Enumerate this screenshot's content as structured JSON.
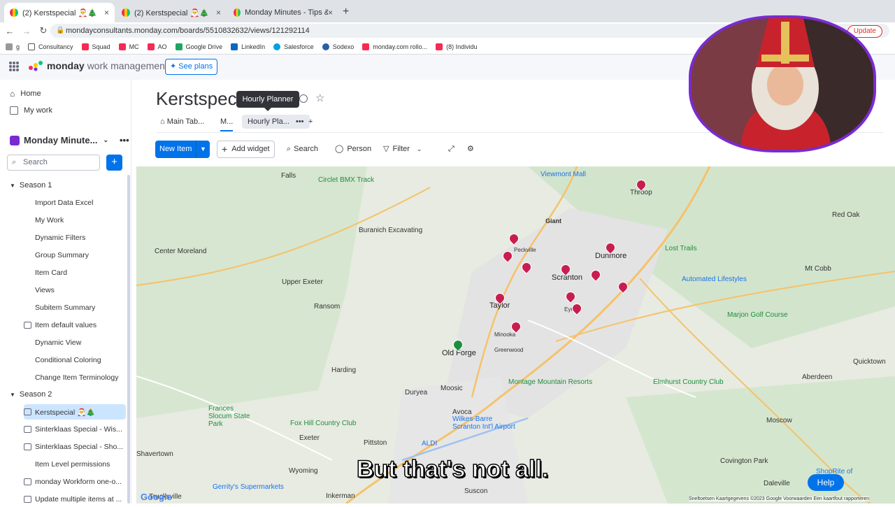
{
  "browser": {
    "tabs": [
      {
        "label": "(2) Kerstspecial 🎅🎄",
        "active": true
      },
      {
        "label": "(2) Kerstspecial 🎅🎄",
        "active": false
      },
      {
        "label": "Monday Minutes - Tips & Tric",
        "active": false
      }
    ],
    "url": "mondayconsultants.monday.com/boards/5510832632/views/121292114",
    "update_label": "Update",
    "bookmarks": [
      "g",
      "Consultancy",
      "Squad",
      "MC",
      "AO",
      "Google Drive",
      "LinkedIn",
      "Salesforce",
      "Sodexo",
      "monday.com rollo...",
      "(8) Individu"
    ]
  },
  "topbar": {
    "brand": "monday",
    "brand_sub": "work management",
    "see_plans": "See plans"
  },
  "sidebar": {
    "home": "Home",
    "my_work": "My work",
    "workspace": "Monday Minute...",
    "search_placeholder": "Search",
    "groups": [
      {
        "name": "Season 1",
        "items": [
          "Import Data Excel",
          "My Work",
          "Dynamic Filters",
          "Group Summary",
          "Item Card",
          "Views",
          "Subitem Summary",
          "Item default values",
          "Dynamic View",
          "Conditional Coloring",
          "Change Item Terminology"
        ]
      },
      {
        "name": "Season 2",
        "items": [
          "Kerstspecial 🎅🎄",
          "Sinterklaas Special - Wis...",
          "Sinterklaas Special - Sho...",
          "Item Level permissions",
          "monday Workform one-o...",
          "Update multiple items at ..."
        ]
      }
    ]
  },
  "board": {
    "title": "Kerstspec",
    "tooltip": "Hourly Planner",
    "view_tabs": [
      "Main Tab...",
      "M...",
      "Hourly Pla..."
    ],
    "toolbar": {
      "new_item": "New Item",
      "add_widget": "Add widget",
      "search": "Search",
      "person": "Person",
      "filter": "Filter"
    }
  },
  "map": {
    "labels": [
      "Falls",
      "Center Moreland",
      "Upper Exeter",
      "Ransom",
      "Harding",
      "Old Forge",
      "Taylor",
      "Scranton",
      "Dunmore",
      "Throop",
      "Red Oak",
      "Mt Cobb",
      "Moosic",
      "Duryea",
      "Pittston",
      "Exeter",
      "Wyoming",
      "Avoca",
      "Shavertown",
      "Trucksville",
      "Inkerman",
      "Suscon",
      "Moscow",
      "Aberdeen",
      "Quicktown",
      "Daleville",
      "Covington Park",
      "Viewmont Mall",
      "Circlet BMX Track",
      "Buranich Excavating",
      "Lost Trails",
      "Automated Lifestyles",
      "Marjon Golf Course",
      "Elmhurst Country Club",
      "Montage Mountain Resorts",
      "Wilkes-Barre Scranton Int'l Airport",
      "Frances Slocum State Park",
      "Fox Hill Country Club",
      "ALDI",
      "Gerrity's Supermarkets",
      "ShopRite of Daleville",
      "Peckville",
      "Giant",
      "Minooka",
      "Greenwood",
      "Eynon"
    ],
    "footer": "Sneltoetsen   Kaartgegevens ©2023 Google   Voorwaarden   Een kaartfout rapporteren",
    "google": "Google"
  },
  "subtitle": "But that's not all.",
  "help": "Help",
  "colors": {
    "accent": "#0073ea",
    "pin_red": "#c81e4f",
    "pin_green": "#1e8e3e"
  }
}
